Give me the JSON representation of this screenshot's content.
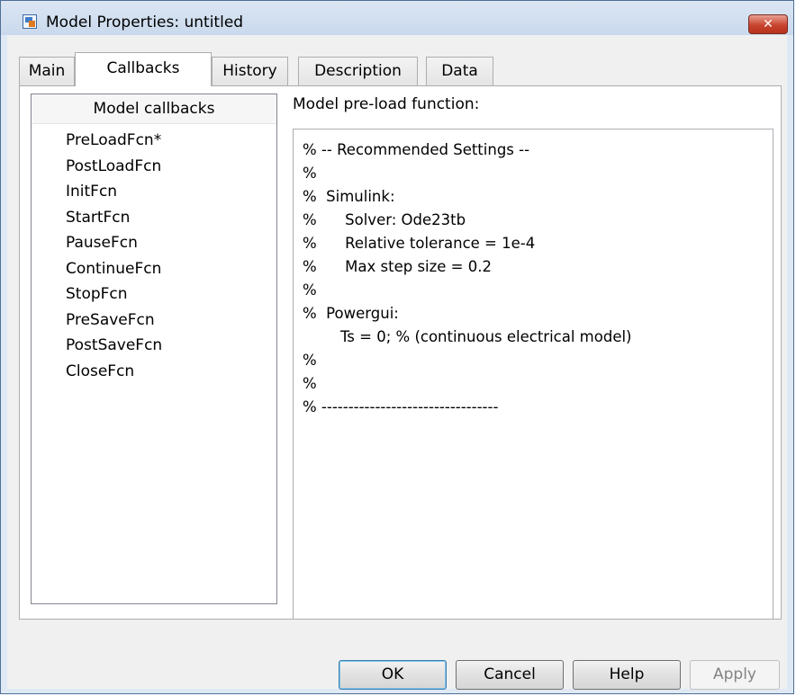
{
  "window": {
    "title": "Model Properties: untitled",
    "close_glyph": "✕"
  },
  "tabs": [
    {
      "label": "Main",
      "active": false
    },
    {
      "label": "Callbacks",
      "active": true
    },
    {
      "label": "History",
      "active": false
    },
    {
      "label": "Description",
      "active": false
    },
    {
      "label": "Data",
      "active": false
    }
  ],
  "callbacks": {
    "header": "Model callbacks",
    "items": [
      "PreLoadFcn*",
      "PostLoadFcn",
      "InitFcn",
      "StartFcn",
      "PauseFcn",
      "ContinueFcn",
      "StopFcn",
      "PreSaveFcn",
      "PostSaveFcn",
      "CloseFcn"
    ],
    "selected": "PreLoadFcn*"
  },
  "editor": {
    "label": "Model pre-load function:",
    "lines": [
      "% -- Recommended Settings --",
      "%",
      "%  Simulink:",
      "%      Solver: Ode23tb",
      "%      Relative tolerance = 1e-4",
      "%      Max step size = 0.2",
      "%",
      "%  Powergui:",
      "        Ts = 0; % (continuous electrical model)",
      "%",
      "%",
      "% ---------------------------------"
    ]
  },
  "buttons": {
    "ok": "OK",
    "cancel": "Cancel",
    "help": "Help",
    "apply": "Apply"
  },
  "icons": {
    "app": "simulink-model-icon",
    "close": "close-icon"
  },
  "colors": {
    "title_bar": "#c9d9ec",
    "close_button": "#c7442f",
    "default_button_border": "#3c7fb1"
  }
}
